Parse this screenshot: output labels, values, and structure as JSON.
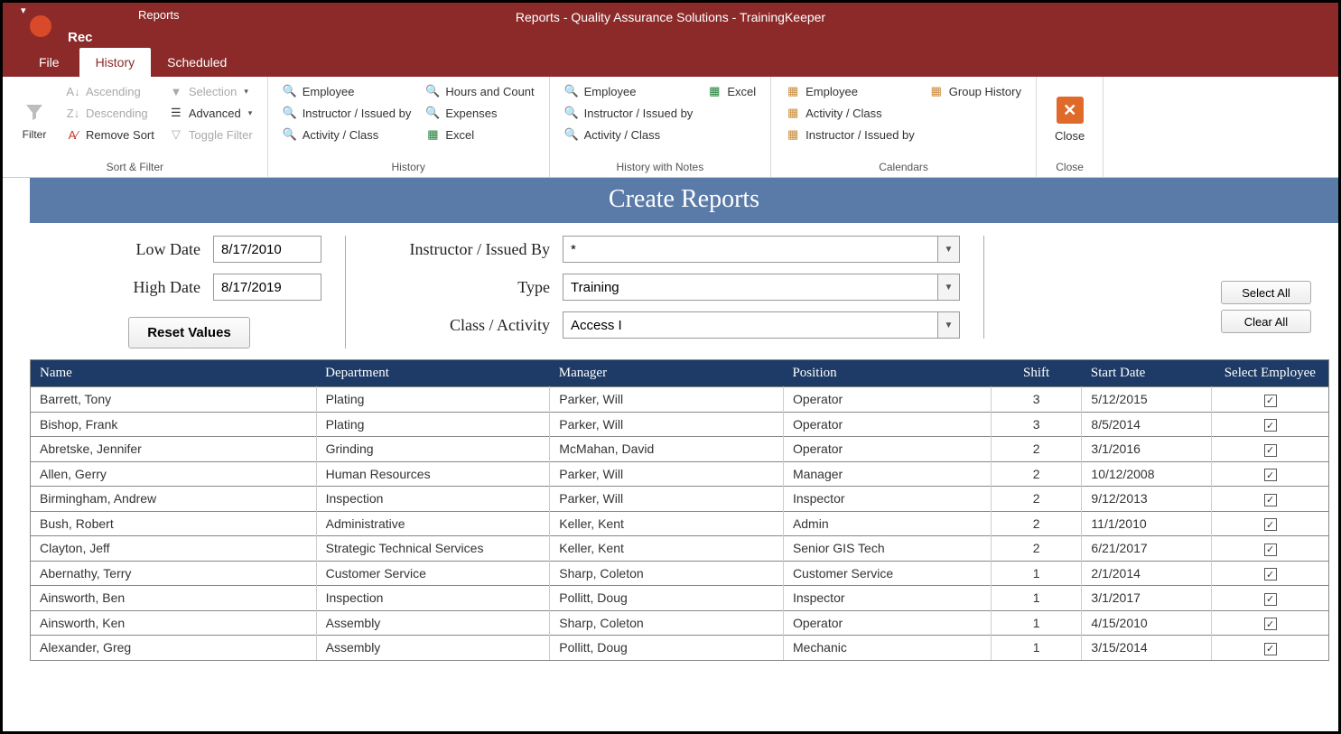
{
  "window": {
    "title": "Reports - Quality Assurance Solutions - TrainingKeeper",
    "rec": "Rec",
    "tabLabel": "Reports"
  },
  "tabs": {
    "file": "File",
    "history": "History",
    "scheduled": "Scheduled"
  },
  "ribbon": {
    "filter": "Filter",
    "sortFilter": {
      "ascending": "Ascending",
      "descending": "Descending",
      "removeSort": "Remove Sort",
      "selection": "Selection",
      "advanced": "Advanced",
      "toggleFilter": "Toggle Filter",
      "group": "Sort & Filter"
    },
    "history": {
      "employee": "Employee",
      "instructor": "Instructor / Issued by",
      "activity": "Activity / Class",
      "hoursCount": "Hours and Count",
      "expenses": "Expenses",
      "excel": "Excel",
      "group": "History"
    },
    "historyNotes": {
      "employee": "Employee",
      "instructor": "Instructor / Issued by",
      "activity": "Activity / Class",
      "excel": "Excel",
      "group": "History with Notes"
    },
    "calendars": {
      "employee": "Employee",
      "activity": "Activity / Class",
      "instructor": "Instructor / Issued by",
      "groupHistory": "Group History",
      "group": "Calendars"
    },
    "close": {
      "label": "Close",
      "group": "Close"
    }
  },
  "banner": "Create Reports",
  "form": {
    "lowDateLabel": "Low Date",
    "lowDate": "8/17/2010",
    "highDateLabel": "High Date",
    "highDate": "8/17/2019",
    "reset": "Reset Values",
    "instructorLabel": "Instructor / Issued By",
    "instructorValue": "*",
    "typeLabel": "Type",
    "typeValue": "Training",
    "classLabel": "Class / Activity",
    "classValue": "Access I",
    "selectAll": "Select All",
    "clearAll": "Clear All"
  },
  "columns": {
    "name": "Name",
    "department": "Department",
    "manager": "Manager",
    "position": "Position",
    "shift": "Shift",
    "startDate": "Start Date",
    "select": "Select Employee"
  },
  "rows": [
    {
      "name": "Barrett, Tony",
      "department": "Plating",
      "manager": "Parker, Will",
      "position": "Operator",
      "shift": "3",
      "startDate": "5/12/2015"
    },
    {
      "name": "Bishop, Frank",
      "department": "Plating",
      "manager": "Parker, Will",
      "position": "Operator",
      "shift": "3",
      "startDate": "8/5/2014"
    },
    {
      "name": "Abretske, Jennifer",
      "department": "Grinding",
      "manager": "McMahan, David",
      "position": "Operator",
      "shift": "2",
      "startDate": "3/1/2016"
    },
    {
      "name": "Allen, Gerry",
      "department": "Human Resources",
      "manager": "Parker, Will",
      "position": "Manager",
      "shift": "2",
      "startDate": "10/12/2008"
    },
    {
      "name": "Birmingham, Andrew",
      "department": "Inspection",
      "manager": "Parker, Will",
      "position": "Inspector",
      "shift": "2",
      "startDate": "9/12/2013"
    },
    {
      "name": "Bush, Robert",
      "department": "Administrative",
      "manager": "Keller, Kent",
      "position": "Admin",
      "shift": "2",
      "startDate": "11/1/2010"
    },
    {
      "name": "Clayton, Jeff",
      "department": "Strategic Technical Services",
      "manager": "Keller, Kent",
      "position": "Senior GIS Tech",
      "shift": "2",
      "startDate": "6/21/2017"
    },
    {
      "name": "Abernathy, Terry",
      "department": "Customer Service",
      "manager": "Sharp, Coleton",
      "position": "Customer Service",
      "shift": "1",
      "startDate": "2/1/2014"
    },
    {
      "name": "Ainsworth, Ben",
      "department": "Inspection",
      "manager": "Pollitt, Doug",
      "position": "Inspector",
      "shift": "1",
      "startDate": "3/1/2017"
    },
    {
      "name": "Ainsworth, Ken",
      "department": "Assembly",
      "manager": "Sharp, Coleton",
      "position": "Operator",
      "shift": "1",
      "startDate": "4/15/2010"
    },
    {
      "name": "Alexander, Greg",
      "department": "Assembly",
      "manager": "Pollitt, Doug",
      "position": "Mechanic",
      "shift": "1",
      "startDate": "3/15/2014"
    }
  ]
}
